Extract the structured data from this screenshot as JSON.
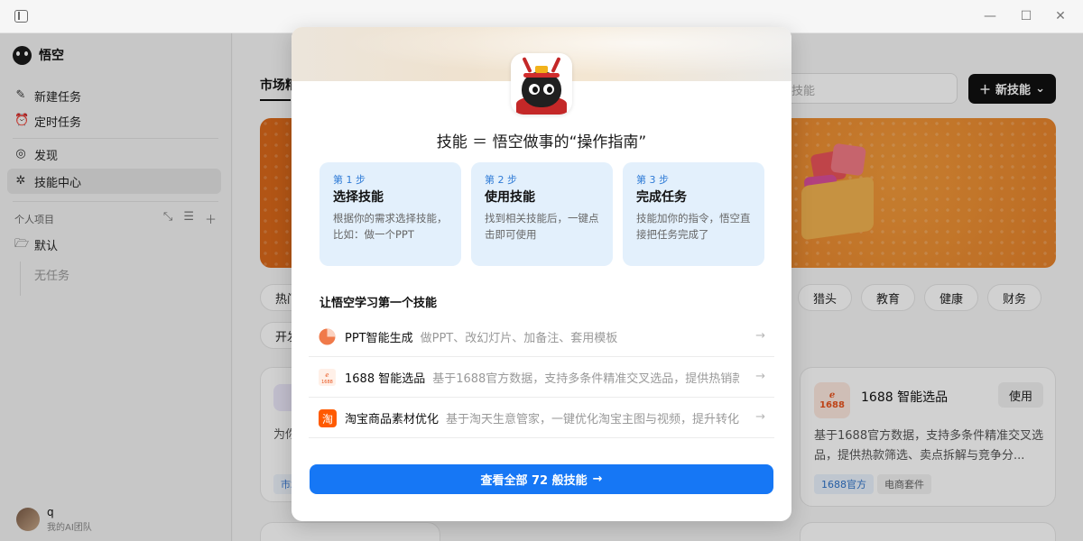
{
  "app": {
    "name": "悟空"
  },
  "sidebar": {
    "nav": [
      {
        "label": "新建任务",
        "icon": "edit-icon"
      },
      {
        "label": "定时任务",
        "icon": "alarm-clock-icon"
      },
      {
        "label": "发现",
        "icon": "planet-icon"
      },
      {
        "label": "技能中心",
        "icon": "puzzle-icon"
      }
    ],
    "projects_title": "个人项目",
    "default_folder": "默认",
    "no_task": "无任务",
    "user": {
      "name": "q",
      "team": "我的AI团队"
    }
  },
  "main": {
    "tab_label": "市场精",
    "search_placeholder": "技能",
    "new_skill_label": "新技能",
    "chips_row1_left": "热门",
    "chips_row1_right": [
      "猎头",
      "教育",
      "健康",
      "财务"
    ],
    "chips_row2_left": "开发",
    "card_right": {
      "title": "1688 智能选品",
      "use_label": "使用",
      "desc": "基于1688官方数据，支持多条件精准交叉选品，提供热款筛选、卖点拆解与竞争分...",
      "tags": [
        "1688官方",
        "电商套件"
      ]
    },
    "card_left": {
      "desc_fragment": "为你",
      "tag_fragment": "市场"
    }
  },
  "modal": {
    "heading": "技能 ＝ 悟空做事的“操作指南”",
    "steps": [
      {
        "num": "第 1 步",
        "title": "选择技能",
        "desc": "根据你的需求选择技能，比如：做一个PPT"
      },
      {
        "num": "第 2 步",
        "title": "使用技能",
        "desc": "找到相关技能后，一键点击即可使用"
      },
      {
        "num": "第 3 步",
        "title": "完成任务",
        "desc": "技能加你的指令，悟空直接把任务完成了"
      }
    ],
    "learn_title": "让悟空学习第一个技能",
    "skills": [
      {
        "name": "PPT智能生成",
        "desc": "做PPT、改幻灯片、加备注、套用模板",
        "icon": "pie-chart-icon"
      },
      {
        "name": "1688 智能选品",
        "desc": "基于1688官方数据，支持多条件精准交叉选品，提供热销款...",
        "icon": "logo-1688-icon"
      },
      {
        "name": "淘宝商品素材优化",
        "desc": "基于淘天生意管家，一键优化淘宝主图与视频，提升转化",
        "icon": "taobao-icon"
      }
    ],
    "view_all_label": "查看全部 72 般技能"
  },
  "colors": {
    "accent": "#1677f5",
    "step_bg": "#e3f0fc",
    "banner_orange": "#d9681a",
    "new_skill_bg": "#111111"
  }
}
